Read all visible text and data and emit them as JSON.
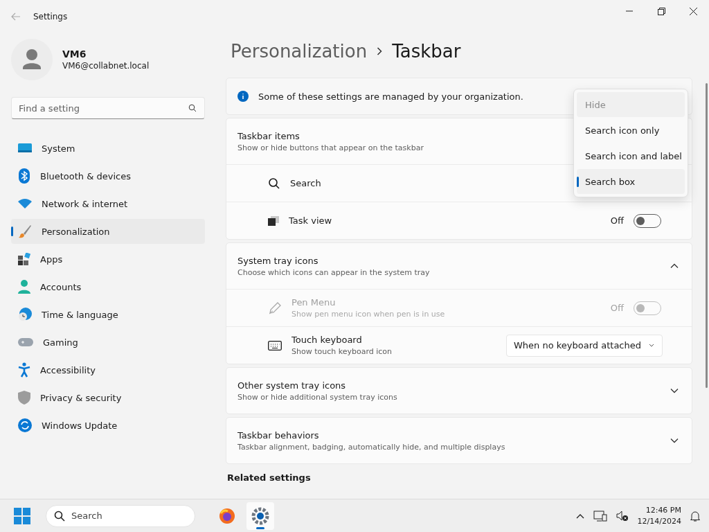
{
  "window": {
    "title": "Settings"
  },
  "user": {
    "name": "VM6",
    "email": "VM6@collabnet.local"
  },
  "search": {
    "placeholder": "Find a setting"
  },
  "nav": [
    {
      "label": "System",
      "selected": false
    },
    {
      "label": "Bluetooth & devices",
      "selected": false
    },
    {
      "label": "Network & internet",
      "selected": false
    },
    {
      "label": "Personalization",
      "selected": true
    },
    {
      "label": "Apps",
      "selected": false
    },
    {
      "label": "Accounts",
      "selected": false
    },
    {
      "label": "Time & language",
      "selected": false
    },
    {
      "label": "Gaming",
      "selected": false
    },
    {
      "label": "Accessibility",
      "selected": false
    },
    {
      "label": "Privacy & security",
      "selected": false
    },
    {
      "label": "Windows Update",
      "selected": false
    }
  ],
  "breadcrumb": {
    "parent": "Personalization",
    "current": "Taskbar"
  },
  "notice": "Some of these settings are managed by your organization.",
  "sections": [
    {
      "title": "Taskbar items",
      "subtitle": "Show or hide buttons that appear on the taskbar",
      "rows": [
        {
          "kind": "menu",
          "label": "Search",
          "disabled": false,
          "options": [
            {
              "label": "Hide",
              "selected": false,
              "disabled": true
            },
            {
              "label": "Search icon only",
              "selected": false,
              "disabled": false
            },
            {
              "label": "Search icon and label",
              "selected": false,
              "disabled": false
            },
            {
              "label": "Search box",
              "selected": true,
              "disabled": false
            }
          ]
        },
        {
          "kind": "toggle",
          "label": "Task view",
          "disabled": false,
          "on": false,
          "state": "Off"
        }
      ]
    },
    {
      "title": "System tray icons",
      "subtitle": "Choose which icons can appear in the system tray",
      "expanded": true,
      "rows": [
        {
          "kind": "toggle",
          "label": "Pen Menu",
          "subtitle": "Show pen menu icon when pen is in use",
          "disabled": true,
          "on": false,
          "state": "Off"
        },
        {
          "kind": "select",
          "label": "Touch keyboard",
          "subtitle": "Show touch keyboard icon",
          "disabled": false,
          "value": "When no keyboard attached"
        }
      ]
    },
    {
      "title": "Other system tray icons",
      "subtitle": "Show or hide additional system tray icons",
      "expanded": false
    },
    {
      "title": "Taskbar behaviors",
      "subtitle": "Taskbar alignment, badging, automatically hide, and multiple displays",
      "expanded": false
    }
  ],
  "related_heading": "Related settings",
  "taskbar": {
    "search_placeholder": "Search",
    "apps": [
      {
        "selected": false
      },
      {
        "selected": true
      }
    ],
    "time": "12:46 PM",
    "date": "12/14/2024"
  }
}
